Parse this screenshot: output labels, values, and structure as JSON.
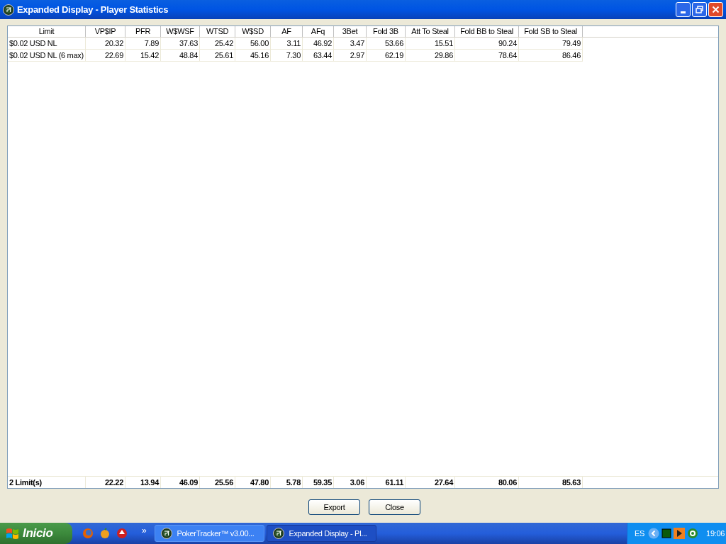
{
  "window": {
    "title": "Expanded Display - Player Statistics"
  },
  "table": {
    "columns": [
      "Limit",
      "VP$IP",
      "PFR",
      "W$WSF",
      "WTSD",
      "W$SD",
      "AF",
      "AFq",
      "3Bet",
      "Fold 3B",
      "Att To Steal",
      "Fold BB to Steal",
      "Fold SB to Steal"
    ],
    "rows": [
      [
        "$0.02 USD NL",
        "20.32",
        "7.89",
        "37.63",
        "25.42",
        "56.00",
        "3.11",
        "46.92",
        "3.47",
        "53.66",
        "15.51",
        "90.24",
        "79.49"
      ],
      [
        "$0.02 USD NL (6 max)",
        "22.69",
        "15.42",
        "48.84",
        "25.61",
        "45.16",
        "7.30",
        "63.44",
        "2.97",
        "62.19",
        "29.86",
        "78.64",
        "86.46"
      ]
    ],
    "totals": [
      "2 Limit(s)",
      "22.22",
      "13.94",
      "46.09",
      "25.56",
      "47.80",
      "5.78",
      "59.35",
      "3.06",
      "61.11",
      "27.64",
      "80.06",
      "85.63"
    ]
  },
  "buttons": [
    "Export",
    "Close"
  ],
  "taskbar": {
    "start": "Inicio",
    "quicklaunch_more": "»",
    "tasks": [
      {
        "label": "PokerTracker™ v3.00...",
        "selected": false
      },
      {
        "label": "Expanded Display - Pl...",
        "selected": true
      }
    ],
    "language": "ES",
    "clock": "19:06"
  }
}
